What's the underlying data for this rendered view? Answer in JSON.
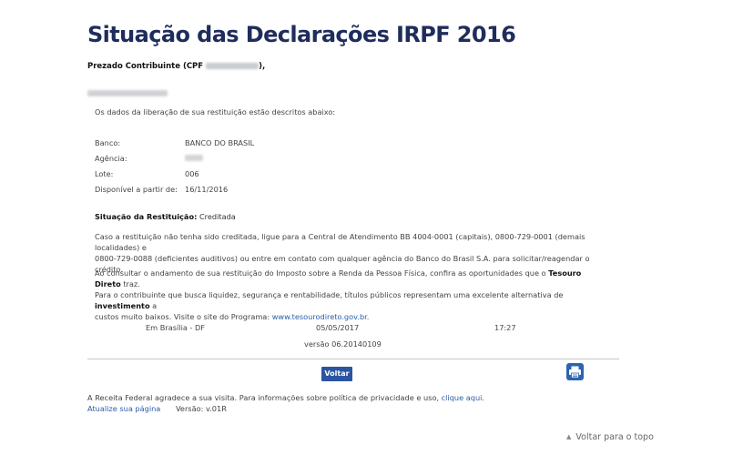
{
  "page": {
    "title": "Situação das Declarações IRPF 2016",
    "greeting_prefix": "Prezado Contribuinte (CPF ",
    "greeting_suffix": "),",
    "intro": "Os dados da liberação de sua restituição estão descritos abaixo:"
  },
  "details": {
    "bank_label": "Banco:",
    "bank_value": "BANCO DO BRASIL",
    "agency_label": "Agência:",
    "lot_label": "Lote:",
    "lot_value": "006",
    "available_label": "Disponível a partir de:",
    "available_value": "16/11/2016"
  },
  "status": {
    "label": "Situação da Restituição:",
    "value": "Creditada"
  },
  "paragraph1": {
    "line1": "Caso a restituição não tenha sido creditada, ligue para a Central de Atendimento BB 4004-0001 (capitais), 0800-729-0001 (demais localidades) e",
    "line2": "0800-729-0088 (deficientes auditivos) ou entre em contato com qualquer agência do Banco do Brasil S.A. para solicitar/reagendar o crédito."
  },
  "paragraph2": {
    "line1_a": "Ao consultar o andamento de sua restituição do Imposto sobre a Renda da Pessoa Física, confira as oportunidades que o ",
    "line1_bold": "Tesouro Direto",
    "line1_b": " traz.",
    "line2_a": "Para o contribuinte que busca liquidez, segurança e rentabilidade, títulos públicos representam uma excelente alternativa de ",
    "line2_bold": "investimento",
    "line2_b": " a",
    "line3_a": "custos muito baixos. Visite o site do Programa: ",
    "line3_link": "www.tesourodireto.gov.br",
    "line3_b": "."
  },
  "meta": {
    "place": "Em Brasília - DF",
    "date": "05/05/2017",
    "time": "17:27",
    "version": "versão 06.20140109"
  },
  "actions": {
    "back_label": "Voltar",
    "print_icon": "printer-icon"
  },
  "footer": {
    "thanks": "A Receita Federal agradece a sua visita. Para informações sobre política de privacidade e uso, ",
    "privacy_link": "clique aqui",
    "thanks_end": ".",
    "update_link": "Atualize sua página",
    "version": "Versão: v.01R",
    "back_to_top": "Voltar para o topo"
  },
  "colors": {
    "title": "#1f2d5c",
    "button": "#2b55a1",
    "link": "#2a5ea8"
  }
}
